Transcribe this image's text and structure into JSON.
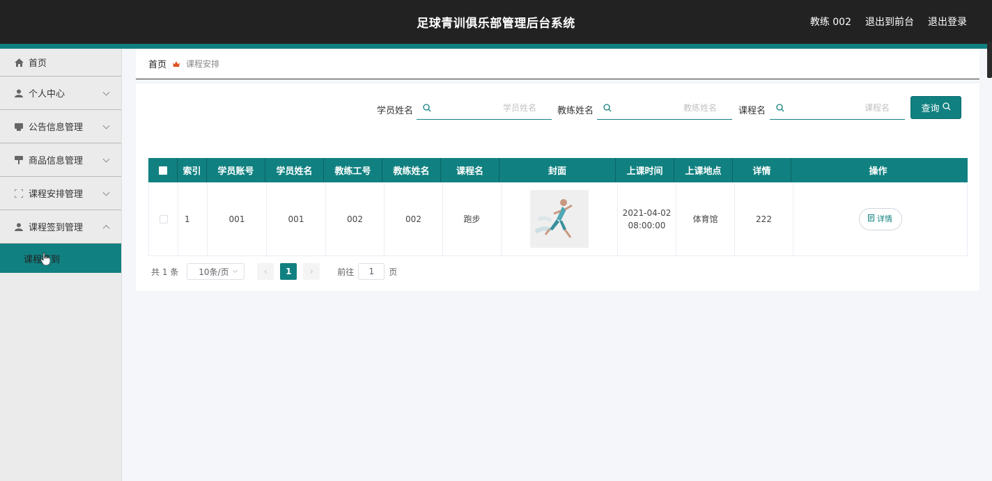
{
  "header": {
    "title": "足球青训俱乐部管理后台系统",
    "user_label": "教练 002",
    "to_front_label": "退出到前台",
    "logout_label": "退出登录"
  },
  "sidebar": {
    "items": [
      {
        "label": "首页",
        "icon": "home-icon"
      },
      {
        "label": "个人中心",
        "icon": "user-icon"
      },
      {
        "label": "公告信息管理",
        "icon": "notice-icon"
      },
      {
        "label": "商品信息管理",
        "icon": "goods-icon"
      },
      {
        "label": "课程安排管理",
        "icon": "frame-icon"
      },
      {
        "label": "课程签到管理",
        "icon": "user-icon"
      }
    ],
    "active_sub": "课程签到"
  },
  "breadcrumb": {
    "home": "首页",
    "current": "课程安排"
  },
  "search": {
    "student_name_label": "学员姓名",
    "student_name_placeholder": "学员姓名",
    "coach_name_label": "教练姓名",
    "coach_name_placeholder": "教练姓名",
    "course_name_label": "课程名",
    "course_name_placeholder": "课程名",
    "query_label": "查询"
  },
  "table": {
    "headers": [
      "索引",
      "学员账号",
      "学员姓名",
      "教练工号",
      "教练姓名",
      "课程名",
      "封面",
      "上课时间",
      "上课地点",
      "详情",
      "操作"
    ],
    "rows": [
      {
        "index": "1",
        "student_account": "001",
        "student_name": "001",
        "coach_id": "002",
        "coach_name": "002",
        "course_name": "跑步",
        "time_date": "2021-04-02",
        "time_clock": "08:00:00",
        "location": "体育馆",
        "detail": "222",
        "action_label": "详情"
      }
    ]
  },
  "pagination": {
    "total": "共 1 条",
    "page_size": "10条/页",
    "current_page": "1",
    "goto_label": "前往",
    "goto_value": "1",
    "page_suffix": "页"
  },
  "colors": {
    "accent": "#118080",
    "header_bg": "#222222"
  }
}
